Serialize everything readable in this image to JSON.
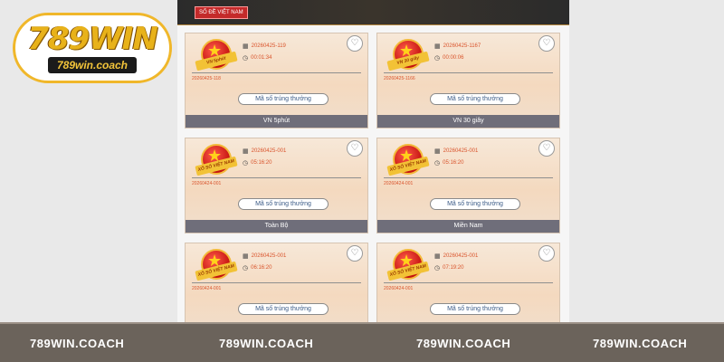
{
  "brand": {
    "logo_main": "789WIN",
    "logo_sub": "789win.coach",
    "colors": {
      "gold": "#e8b21a",
      "footer_bg": "#6b635b",
      "tab_red": "#c42a2a"
    }
  },
  "panel": {
    "tab_label": "SỐ ĐỀ VIỆT NAM",
    "button_label": "Mã số trúng thưởng",
    "cards": [
      {
        "medal": "VN 5phút",
        "draw": "20260425-119",
        "time": "00:01:34",
        "prev": "20260425-118",
        "caption": "VN 5phút"
      },
      {
        "medal": "VN 30 giây",
        "draw": "20260425-1167",
        "time": "00:00:06",
        "prev": "20260425-1166",
        "caption": "VN 30 giây"
      },
      {
        "medal": "XỔ SỐ VIỆT NAM",
        "draw": "20260425-001",
        "time": "05:16:20",
        "prev": "20260424-001",
        "caption": "Toàn Bộ"
      },
      {
        "medal": "XỔ SỐ VIỆT NAM",
        "draw": "20260425-001",
        "time": "05:16:20",
        "prev": "20260424-001",
        "caption": "Miền Nam"
      },
      {
        "medal": "XỔ SỐ VIỆT NAM",
        "draw": "20260425-001",
        "time": "06:16:20",
        "prev": "20260424-001",
        "caption": ""
      },
      {
        "medal": "XỔ SỐ VIỆT NAM",
        "draw": "20260425-001",
        "time": "07:19:20",
        "prev": "20260424-001",
        "caption": ""
      }
    ]
  },
  "footer": {
    "items": [
      "789WIN.COACH",
      "789WIN.COACH",
      "789WIN.COACH",
      "789WIN.COACH"
    ]
  },
  "icons": {
    "favorite": "heart-icon",
    "calendar": "calendar-icon",
    "clock": "clock-icon"
  }
}
